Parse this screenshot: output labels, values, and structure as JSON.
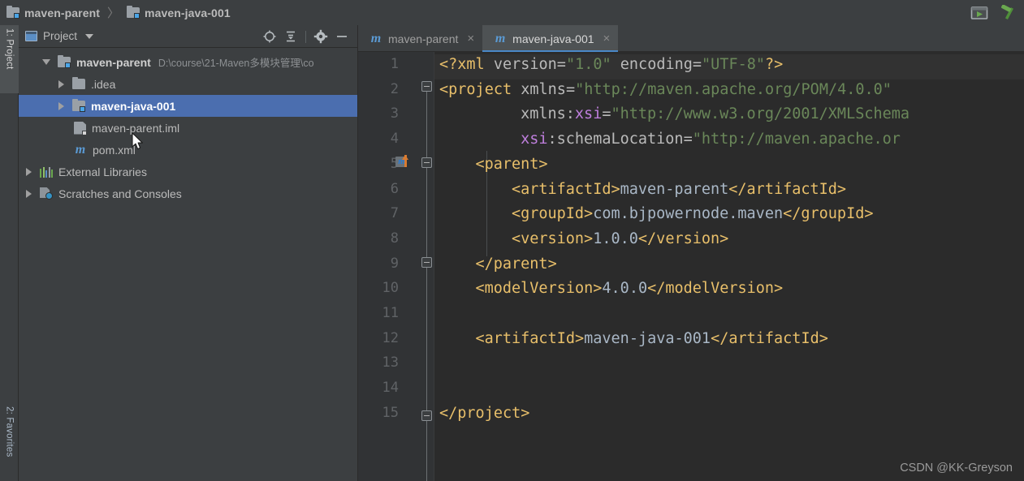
{
  "breadcrumb": {
    "items": [
      {
        "label": "maven-parent",
        "icon": "module-folder-icon"
      },
      {
        "label": "maven-java-001",
        "icon": "module-folder-icon"
      }
    ],
    "separator": "〉"
  },
  "titlebar_actions": [
    {
      "name": "run-window-icon",
      "tooltip": "Run"
    },
    {
      "name": "build-hammer-icon",
      "tooltip": "Build"
    }
  ],
  "tool_window_strip": {
    "top": {
      "label": "1: Project",
      "active": true
    },
    "bottom": {
      "label": "2: Favorites",
      "active": false
    }
  },
  "project_panel": {
    "title": "Project",
    "title_icon": "project-window-icon",
    "dropdown_icon": "chevron-down-icon",
    "actions": [
      {
        "name": "locate-crosshair-icon",
        "glyph": "⊕"
      },
      {
        "name": "collapse-all-icon",
        "glyph": "≡"
      },
      {
        "name": "settings-gear-icon",
        "glyph": "⚙"
      },
      {
        "name": "hide-minimize-icon",
        "glyph": "—"
      }
    ],
    "tree": [
      {
        "label": "maven-parent",
        "path": "D:\\course\\21-Maven多模块管理\\co",
        "icon": "module-folder-icon",
        "arrow": "down",
        "indent": 0,
        "bold": true,
        "selected": false
      },
      {
        "label": ".idea",
        "path": "",
        "icon": "folder-icon",
        "arrow": "right",
        "indent": 1,
        "bold": false,
        "selected": false
      },
      {
        "label": "maven-java-001",
        "path": "",
        "icon": "module-folder-icon",
        "arrow": "right",
        "indent": 1,
        "bold": true,
        "selected": true
      },
      {
        "label": "maven-parent.iml",
        "path": "",
        "icon": "iml-file-icon",
        "arrow": "none",
        "indent": 2,
        "bold": false,
        "selected": false
      },
      {
        "label": "pom.xml",
        "path": "",
        "icon": "maven-pom-icon",
        "arrow": "none",
        "indent": 2,
        "bold": false,
        "selected": false
      },
      {
        "label": "External Libraries",
        "path": "",
        "icon": "libraries-bars-icon",
        "arrow": "right",
        "indent": 0,
        "bold": false,
        "selected": false
      },
      {
        "label": "Scratches and Consoles",
        "path": "",
        "icon": "scratches-icon",
        "arrow": "right",
        "indent": 0,
        "bold": false,
        "selected": false
      }
    ]
  },
  "editor": {
    "tabs": [
      {
        "label": "maven-parent",
        "icon": "maven-pom-icon",
        "active": false,
        "close_glyph": "×"
      },
      {
        "label": "maven-java-001",
        "icon": "maven-pom-icon",
        "active": true,
        "close_glyph": "×"
      }
    ],
    "line_numbers": [
      "1",
      "2",
      "3",
      "4",
      "5",
      "6",
      "7",
      "8",
      "9",
      "10",
      "11",
      "12",
      "13",
      "14",
      "15"
    ],
    "caret_line": 1,
    "lines": [
      {
        "n": 1,
        "tokens": [
          {
            "t": "<?xml ",
            "c": "tk-punct"
          },
          {
            "t": "version",
            "c": "tk-attr"
          },
          {
            "t": "=",
            "c": "tk-attr"
          },
          {
            "t": "\"1.0\"",
            "c": "tk-str"
          },
          {
            "t": " ",
            "c": "tk-attr"
          },
          {
            "t": "encoding",
            "c": "tk-attr"
          },
          {
            "t": "=",
            "c": "tk-attr"
          },
          {
            "t": "\"UTF-8\"",
            "c": "tk-str"
          },
          {
            "t": "?>",
            "c": "tk-punct"
          }
        ]
      },
      {
        "n": 2,
        "tokens": [
          {
            "t": "<project",
            "c": "tk-tag"
          },
          {
            "t": " ",
            "c": "tk-attr"
          },
          {
            "t": "xmlns",
            "c": "tk-attr"
          },
          {
            "t": "=",
            "c": "tk-attr"
          },
          {
            "t": "\"http://maven.apache.org/POM/4.0.0\"",
            "c": "tk-str"
          }
        ]
      },
      {
        "n": 3,
        "indent": 9,
        "tokens": [
          {
            "t": "xmlns",
            "c": "tk-attr"
          },
          {
            "t": ":",
            "c": "tk-attr"
          },
          {
            "t": "xsi",
            "c": "tk-ns"
          },
          {
            "t": "=",
            "c": "tk-attr"
          },
          {
            "t": "\"http://www.w3.org/2001/XMLSchema",
            "c": "tk-str"
          }
        ]
      },
      {
        "n": 4,
        "indent": 9,
        "tokens": [
          {
            "t": "xsi",
            "c": "tk-ns"
          },
          {
            "t": ":",
            "c": "tk-attr"
          },
          {
            "t": "schemaLocation",
            "c": "tk-attr"
          },
          {
            "t": "=",
            "c": "tk-attr"
          },
          {
            "t": "\"http://maven.apache.or",
            "c": "tk-str"
          }
        ]
      },
      {
        "n": 5,
        "indent": 4,
        "tokens": [
          {
            "t": "<parent>",
            "c": "tk-tag"
          }
        ]
      },
      {
        "n": 6,
        "indent": 8,
        "tokens": [
          {
            "t": "<artifactId>",
            "c": "tk-tag"
          },
          {
            "t": "maven-parent",
            "c": "tk-text"
          },
          {
            "t": "</artifactId>",
            "c": "tk-tag"
          }
        ]
      },
      {
        "n": 7,
        "indent": 8,
        "tokens": [
          {
            "t": "<groupId>",
            "c": "tk-tag"
          },
          {
            "t": "com.bjpowernode.maven",
            "c": "tk-text"
          },
          {
            "t": "</groupId>",
            "c": "tk-tag"
          }
        ]
      },
      {
        "n": 8,
        "indent": 8,
        "tokens": [
          {
            "t": "<version>",
            "c": "tk-tag"
          },
          {
            "t": "1.0.0",
            "c": "tk-text"
          },
          {
            "t": "</version>",
            "c": "tk-tag"
          }
        ]
      },
      {
        "n": 9,
        "indent": 4,
        "tokens": [
          {
            "t": "</parent>",
            "c": "tk-tag"
          }
        ]
      },
      {
        "n": 10,
        "indent": 4,
        "tokens": [
          {
            "t": "<modelVersion>",
            "c": "tk-tag"
          },
          {
            "t": "4.0.0",
            "c": "tk-text"
          },
          {
            "t": "</modelVersion>",
            "c": "tk-tag"
          }
        ]
      },
      {
        "n": 11,
        "indent": 0,
        "tokens": []
      },
      {
        "n": 12,
        "indent": 4,
        "tokens": [
          {
            "t": "<artifactId>",
            "c": "tk-tag"
          },
          {
            "t": "maven-java-001",
            "c": "tk-text"
          },
          {
            "t": "</artifactId>",
            "c": "tk-tag"
          }
        ]
      },
      {
        "n": 13,
        "indent": 0,
        "tokens": []
      },
      {
        "n": 14,
        "indent": 0,
        "tokens": []
      },
      {
        "n": 15,
        "indent": 0,
        "tokens": [
          {
            "t": "</project>",
            "c": "tk-tag"
          }
        ]
      }
    ],
    "gutter_icons": [
      {
        "name": "maven-reimport-icon",
        "line": 5
      }
    ],
    "fold_markers": [
      {
        "line": 2,
        "type": "open"
      },
      {
        "line": 5,
        "type": "open"
      },
      {
        "line": 9,
        "type": "close"
      },
      {
        "line": 15,
        "type": "close"
      }
    ]
  },
  "watermark": "CSDN @KK-Greyson",
  "colors": {
    "panel_bg": "#3c3f41",
    "editor_bg": "#2b2b2b",
    "gutter_bg": "#313335",
    "selection": "#4b6eaf",
    "tab_active": "#4e5254",
    "tab_underline": "#4a88c7",
    "tag": "#e8bf6a",
    "string": "#6a8759",
    "text": "#a9b7c6",
    "namespace": "#bf7fdd",
    "accent_blue": "#4ba6e8",
    "hammer_green": "#5a9e3f",
    "maven_orange": "#d97b30"
  }
}
